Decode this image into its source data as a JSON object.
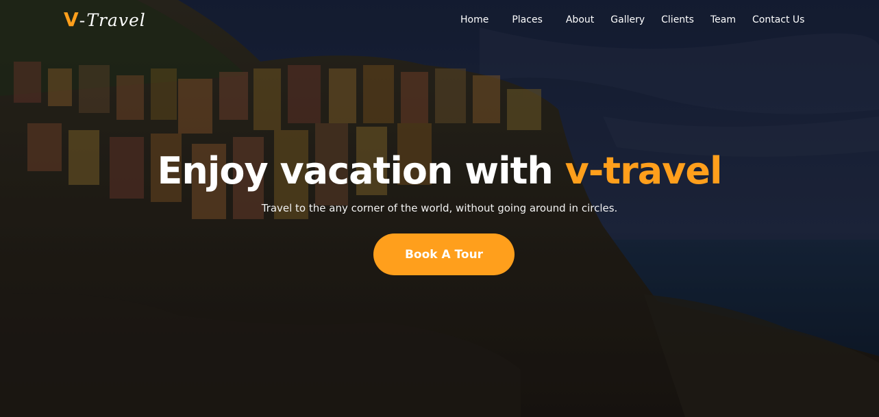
{
  "brand": {
    "mark": "V",
    "separator": "-",
    "wordmark": "Travel",
    "accent_color": "#ff9f1c"
  },
  "nav": {
    "items": [
      {
        "label": "Home"
      },
      {
        "label": "Places"
      },
      {
        "label": "About"
      },
      {
        "label": "Gallery"
      },
      {
        "label": "Clients"
      },
      {
        "label": "Team"
      },
      {
        "label": "Contact Us"
      }
    ]
  },
  "hero": {
    "headline_main": "Enjoy vacation with ",
    "headline_accent": "v-travel",
    "subtitle": "Travel to the any corner of the world, without going around in circles.",
    "cta_label": "Book A Tour",
    "background": "coastal-cliff-village-photo"
  }
}
